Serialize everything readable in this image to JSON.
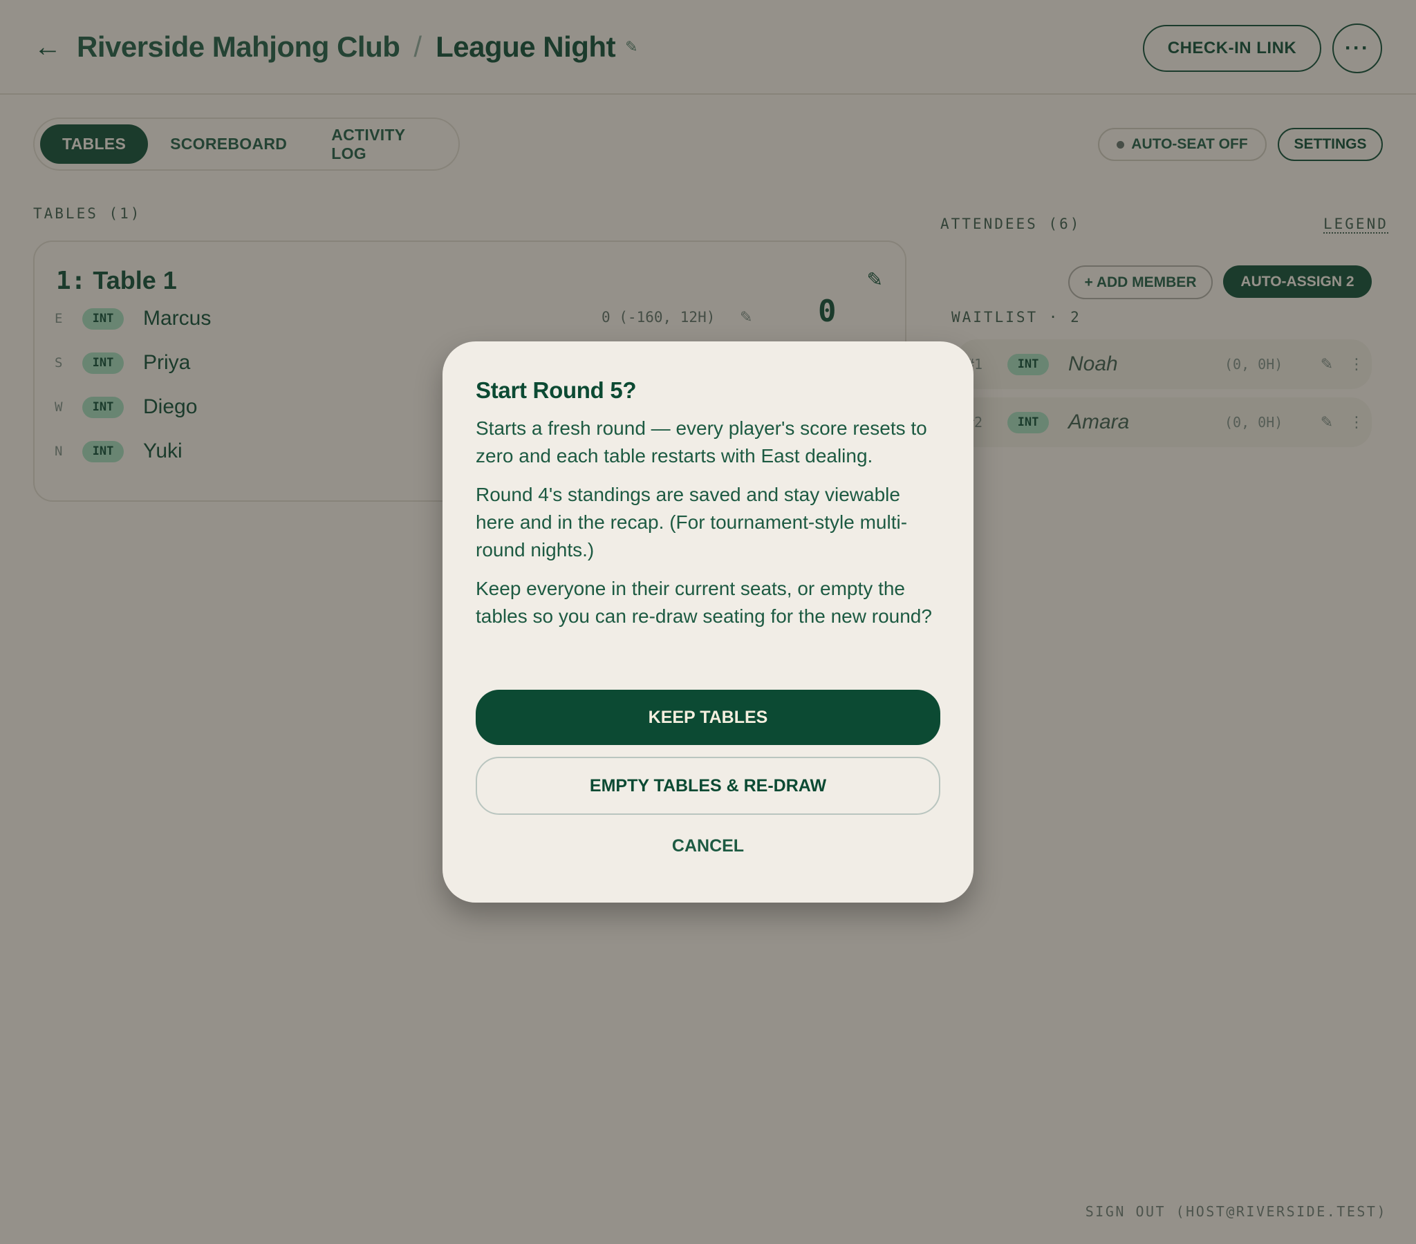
{
  "header": {
    "back_icon": "arrow-left-icon",
    "club": "Riverside Mahjong Club",
    "separator": "/",
    "event": "League Night",
    "edit_icon": "pencil-icon",
    "checkin_label": "CHECK-IN LINK",
    "more_label": "···"
  },
  "tabs": [
    {
      "label": "TABLES",
      "active": true
    },
    {
      "label": "SCOREBOARD",
      "active": false
    },
    {
      "label": "ACTIVITY LOG",
      "active": false
    }
  ],
  "toolbar": {
    "autoseat_label": "AUTO-SEAT OFF",
    "settings_label": "SETTINGS"
  },
  "tables": {
    "heading": "TABLES (1)",
    "table": {
      "number": "1:",
      "name": "Table 1",
      "players": [
        {
          "seat": "E",
          "badge": "INT",
          "name": "Marcus"
        },
        {
          "seat": "S",
          "badge": "INT",
          "name": "Priya"
        },
        {
          "seat": "W",
          "badge": "INT",
          "name": "Diego"
        },
        {
          "seat": "N",
          "badge": "INT",
          "name": "Yuki"
        }
      ],
      "score_detail": "0 (-160, 12H)",
      "big_score": "0"
    }
  },
  "attendees": {
    "heading": "ATTENDEES (6)",
    "legend_label": "LEGEND",
    "add_member_label": "+ ADD MEMBER",
    "auto_assign_label": "AUTO-ASSIGN 2",
    "waitlist_heading": "WAITLIST · 2",
    "waitlist": [
      {
        "rank": "#1",
        "badge": "INT",
        "name": "Noah",
        "score": "(0, 0H)"
      },
      {
        "rank": "#2",
        "badge": "INT",
        "name": "Amara",
        "score": "(0, 0H)"
      }
    ]
  },
  "footer": {
    "signout": "SIGN OUT (HOST@RIVERSIDE.TEST)"
  },
  "modal": {
    "title": "Start Round 5?",
    "paragraphs": [
      "Starts a fresh round — every player's score resets to zero and each table restarts with East dealing.",
      "Round 4's standings are saved and stay viewable here and in the recap. (For tournament-style multi-round nights.)",
      "Keep everyone in their current seats, or empty the tables so you can re-draw seating for the new round?"
    ],
    "keep_label": "KEEP TABLES",
    "empty_label": "EMPTY TABLES & RE-DRAW",
    "cancel_label": "CANCEL"
  },
  "colors": {
    "brand": "#0c4a33",
    "background": "#f2ede4",
    "badge": "#9fd6b8",
    "overlay": "rgba(44,42,36,0.47)"
  }
}
